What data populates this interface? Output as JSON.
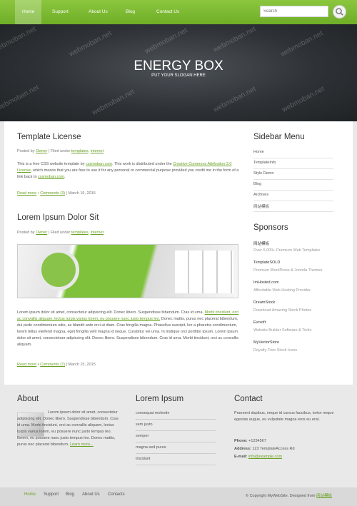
{
  "nav": {
    "items": [
      "Home",
      "Support",
      "About Us",
      "Blog",
      "Contact Us"
    ],
    "search_placeholder": "Search"
  },
  "header": {
    "title": "ENERGY BOX",
    "slogan": "PUT YOUR SLOGAN HERE",
    "watermark": "webmoban.net"
  },
  "posts": [
    {
      "title": "Template License",
      "meta": {
        "by": "Posted by",
        "author": "Owner",
        "filed": "| Filed under",
        "cat1": "templates",
        "sep": ",",
        "cat2": "internet"
      },
      "body": {
        "t1": "This is a free CSS website template by ",
        "l1": "cssmoban.com",
        "t2": ". This work is distributed under the ",
        "l2": "Creative Commons Attribution 3.0 License",
        "t3": ", which means that you are free to use it for any personal or commercial purpose provided you credit me in the form of a link back to ",
        "l3": "cssmoban.com",
        "t4": "."
      },
      "read_more": "Read more",
      "comments": "Comments (3)",
      "date": "| March 16, 2015"
    },
    {
      "title": "Lorem Ipsum Dolor Sit",
      "meta": {
        "by": "Posted by",
        "author": "Owner",
        "filed": "| Filed under",
        "cat1": "templates",
        "sep": ",",
        "cat2": "internet"
      },
      "body": {
        "t1": "Lorem ipsum dolor sit amet, consectetur adipiscing elit. Donec libero. Suspendisse bibendum. Cras id urna. ",
        "l1": "Morbi tincidunt, orci ac convallis aliquam, lectus turpis varius lorem, eu posuere nunc justo tempus leo.",
        "t2": " Donec mattis, purus nec placerat bibendum, dui pede condimentum odio, ac blandit ante orci ut diam. Cras fringilla magna. Phasellus suscipit, leo a pharetra condimentum, lorem tellus eleifend magna, eget fringilla velit magna id neque. Curabitur vel urna. In tristique orci porttitor ipsum. Lorem ipsum dolor sit amet, consectetuer adipiscing elit. Donec libero. Suspendisse bibendum. Cras id urna. Morbi tincidunt, orci ac convallis aliquam."
      },
      "read_more": "Read more",
      "comments": "Comments (7)",
      "date": "| March 15, 2015"
    }
  ],
  "sidebar": {
    "menu_title": "Sidebar Menu",
    "menu": [
      "Home",
      "TemplateInfo",
      "Style Demo",
      "Blog",
      "Archives",
      "网站模板"
    ],
    "sponsors_title": "Sponsors",
    "sponsors": [
      {
        "name": "网站模板",
        "desc": "Over 6,000+ Premium Web Templates"
      },
      {
        "name": "TemplateSOLD",
        "desc": "Premium WordPress & Joomla Themes"
      },
      {
        "name": "ImHosted.com",
        "desc": "Affordable Web Hosting Provider"
      },
      {
        "name": "DreamStock",
        "desc": "Download Amazing Stock Photos"
      },
      {
        "name": "Evrsoft",
        "desc": "Website Builder Software & Tools"
      },
      {
        "name": "MyVectorStore",
        "desc": "Royalty Free Stock Icons"
      }
    ]
  },
  "about": {
    "title": "About",
    "text": "Lorem ipsum dolor sit amet, consectetur adipiscing elit. Donec libero. Suspendisse bibendum. Cras id urna. Morbi tincidunt, orci ac convallis aliquam, lectus turpis varius lorem, eu posuere nunc justo tempus leo. llorem, eu posuere nunc justo tempus leo. Donec mattis, purus nec placerat bibendum.",
    "learn_more": "Learn more..."
  },
  "lorem": {
    "title": "Lorem Ipsum",
    "links": [
      "consequat molestie",
      "sem justo",
      "semper",
      "magna sed purus",
      "tincidunt"
    ]
  },
  "contact": {
    "title": "Contact",
    "text": "Praesent dapibus, neque id cursus faucibus, tortor neque egestas augue, eu vulputate magna eros eu erat.",
    "phone_label": "Phone:",
    "phone": "+1234567",
    "address_label": "Address:",
    "address": "123 TemplateAccess Rd",
    "email_label": "E-mail:",
    "email": "info@example.com"
  },
  "footer": {
    "items": [
      "Home",
      "Support",
      "Blog",
      "About Us",
      "Contacts"
    ],
    "copyright": "© Copyright MyWebSite. Designed from ",
    "designer": "网站模板"
  },
  "colors": {
    "accent": "#7dbb36",
    "header_bg": "#2f3337",
    "footer_bg": "#d9d9d9"
  }
}
